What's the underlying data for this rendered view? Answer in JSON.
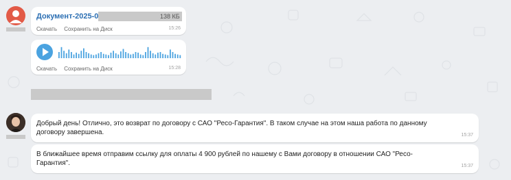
{
  "messages": {
    "document": {
      "title": "Документ-2025-05-",
      "size": "138 КБ",
      "download_label": "Скачать",
      "save_label": "Сохранить на Диск",
      "time": "15:26"
    },
    "voice": {
      "download_label": "Скачать",
      "save_label": "Сохранить на Диск",
      "time": "15:28"
    },
    "reply1": {
      "text": "Добрый день! Отлично, это возврат по договору с САО \"Ресо-Гарантия\". В таком случае на этом наша работа по данному договору завершена.",
      "time": "15:37"
    },
    "reply2": {
      "text": "В ближайшее время отправим ссылку для оплаты 4 900 рублей по нашему с Вами договору в отношении САО \"Ресо-Гарантия\".",
      "time": "15:37"
    }
  },
  "colors": {
    "accent": "#4ba3e0",
    "link": "#2c6fb3",
    "user_avatar": "#e25a47"
  }
}
